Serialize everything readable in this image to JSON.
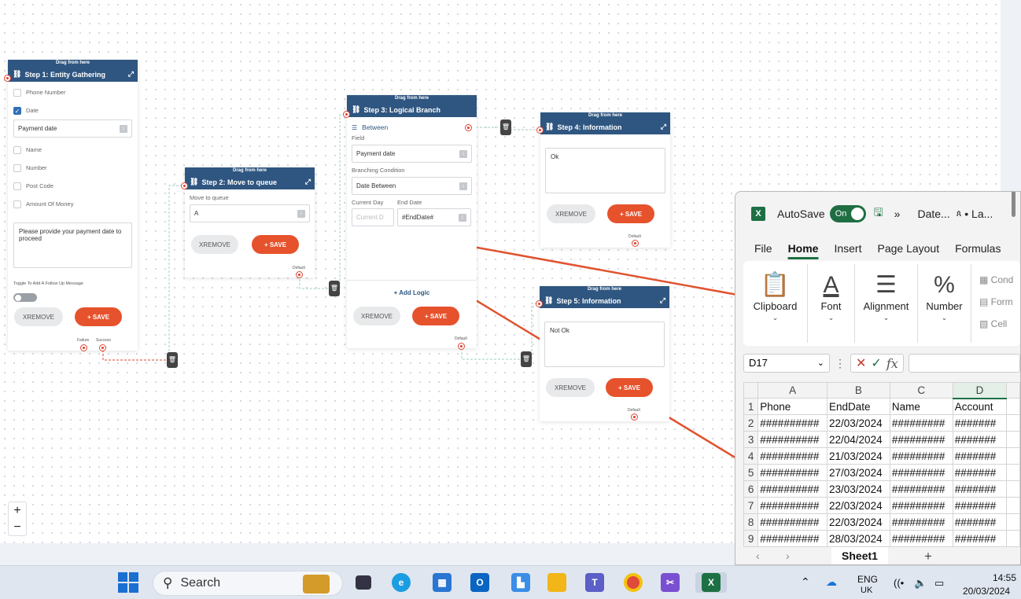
{
  "flow": {
    "drag_label": "Drag from here",
    "remove_label": "XREMOVE",
    "save_label": "+ SAVE",
    "default_label": "Default",
    "step1": {
      "title": "Step 1: Entity Gathering",
      "checkboxes": [
        {
          "label": "Phone Number",
          "checked": false
        },
        {
          "label": "Date",
          "checked": true
        }
      ],
      "date_select": "Payment date",
      "checkboxes2": [
        {
          "label": "Name",
          "checked": false
        },
        {
          "label": "Number",
          "checked": false
        },
        {
          "label": "Post Code",
          "checked": false
        },
        {
          "label": "Amount Of Money",
          "checked": false
        }
      ],
      "message": "Please provide your payment date to proceed",
      "toggle_label": "Toggle To Add A Follow Up Message",
      "failure_label": "Failure",
      "success_label": "Success"
    },
    "step2": {
      "title": "Step 2: Move to queue",
      "queue_label": "Move to queue",
      "queue_value": "A"
    },
    "step3": {
      "title": "Step 3: Logical Branch",
      "mode": "Between",
      "field_label": "Field",
      "field_value": "Payment date",
      "condition_label": "Branching Condition",
      "condition_value": "Date Between",
      "current_day_label": "Current Day",
      "end_date_label": "End Date",
      "current_day_placeholder": "Current D",
      "end_date_value": "#EndDate#",
      "add_logic": "+ Add Logic"
    },
    "step4": {
      "title": "Step 4: Information",
      "message": "Ok"
    },
    "step5": {
      "title": "Step 5: Information",
      "message": "Not Ok"
    },
    "zoom_in": "+",
    "zoom_out": "−"
  },
  "excel": {
    "autosave_label": "AutoSave",
    "autosave_state": "On",
    "title_more": "»",
    "doc_name": "Date...",
    "user": "• La...",
    "tabs": [
      "File",
      "Home",
      "Insert",
      "Page Layout",
      "Formulas"
    ],
    "active_tab": "Home",
    "ribbon_groups": [
      "Clipboard",
      "Font",
      "Alignment",
      "Number"
    ],
    "ribbon_small": [
      "Cond",
      "Form",
      "Cell"
    ],
    "name_box": "D17",
    "fx": "fx",
    "columns": [
      "A",
      "B",
      "C",
      "D"
    ],
    "rows": [
      [
        "1",
        "Phone",
        "EndDate",
        "Name",
        "Account"
      ],
      [
        "2",
        "##########",
        "22/03/2024",
        "#########",
        "#######"
      ],
      [
        "3",
        "##########",
        "22/04/2024",
        "#########",
        "#######"
      ],
      [
        "4",
        "##########",
        "21/03/2024",
        "#########",
        "#######"
      ],
      [
        "5",
        "##########",
        "27/03/2024",
        "#########",
        "#######"
      ],
      [
        "6",
        "##########",
        "23/03/2024",
        "#########",
        "#######"
      ],
      [
        "7",
        "##########",
        "22/03/2024",
        "#########",
        "#######"
      ],
      [
        "8",
        "##########",
        "22/03/2024",
        "#########",
        "#######"
      ],
      [
        "9",
        "##########",
        "28/03/2024",
        "#########",
        "#######"
      ]
    ],
    "sheet": "Sheet1",
    "add_sheet": "+"
  },
  "taskbar": {
    "search_placeholder": "Search",
    "lang": "ENG",
    "region": "UK",
    "time": "14:55",
    "date": "20/03/2024"
  }
}
